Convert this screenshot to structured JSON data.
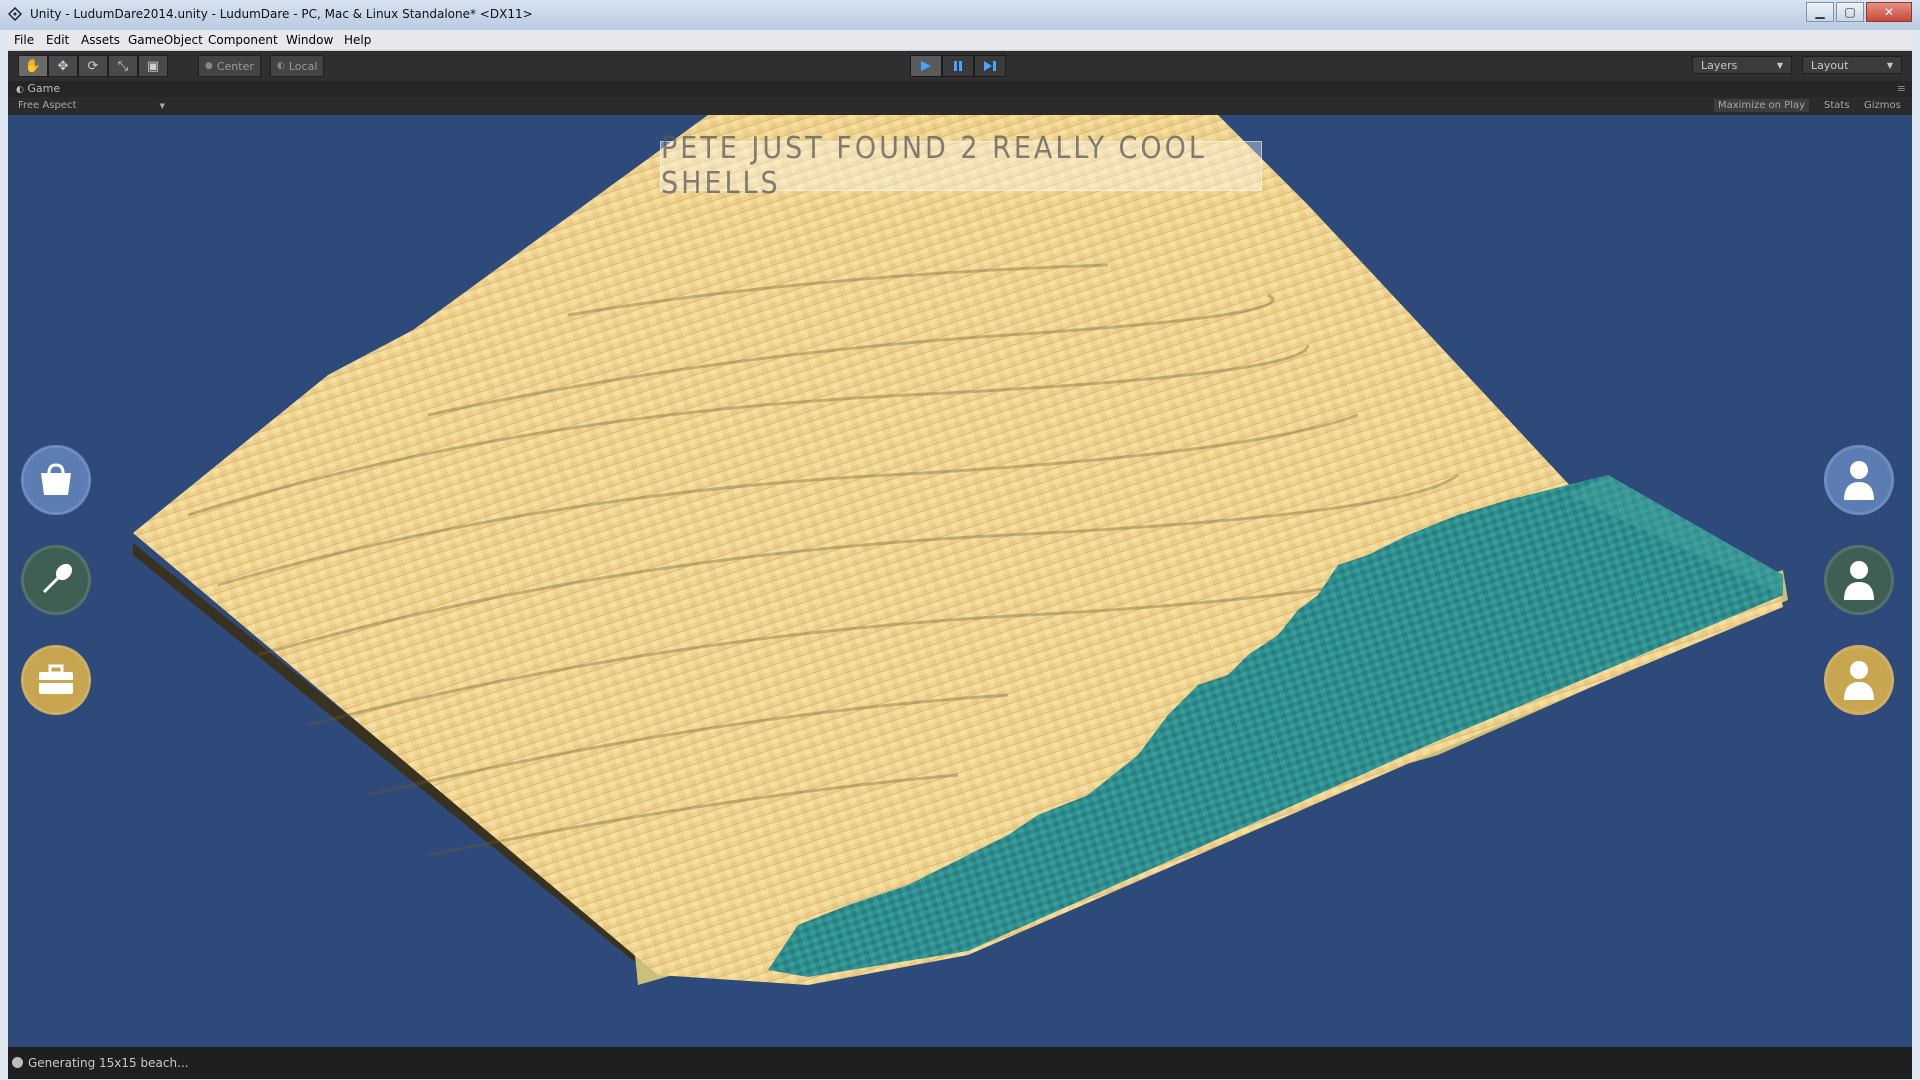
{
  "window": {
    "title": "Unity - LudumDare2014.unity - LudumDare - PC, Mac & Linux Standalone* <DX11>",
    "controls": [
      "minimize",
      "maximize",
      "close"
    ]
  },
  "menubar": {
    "items": [
      "File",
      "Edit",
      "Assets",
      "GameObject",
      "Component",
      "Window",
      "Help"
    ]
  },
  "toolbar": {
    "tools": [
      "hand-icon",
      "move-icon",
      "rotate-icon",
      "scale-icon",
      "rect-icon"
    ],
    "pivot_center": "Center",
    "pivot_local": "Local",
    "playback": [
      "play",
      "pause",
      "step"
    ],
    "layers_label": "Layers",
    "layout_label": "Layout"
  },
  "game_tab": {
    "label": "Game",
    "aspect": "Free Aspect",
    "maximize_on_play": "Maximize on Play",
    "stats": "Stats",
    "gizmos": "Gizmos"
  },
  "game": {
    "message": "PETE JUST FOUND 2 REALLY COOL SHELLS",
    "left_buttons": [
      "bag-icon",
      "shovel-icon",
      "briefcase-icon"
    ],
    "right_buttons": [
      "person-icon",
      "person-icon",
      "person-icon"
    ],
    "colors": {
      "background": "#2e4a7a",
      "sand": "#f0d58e",
      "water": "#2f8f8f",
      "blue_button": "#4f6fa0",
      "teal_button": "#3c5a52",
      "gold_button": "#c7a64f"
    }
  },
  "status": {
    "text": "Generating 15x15 beach..."
  }
}
